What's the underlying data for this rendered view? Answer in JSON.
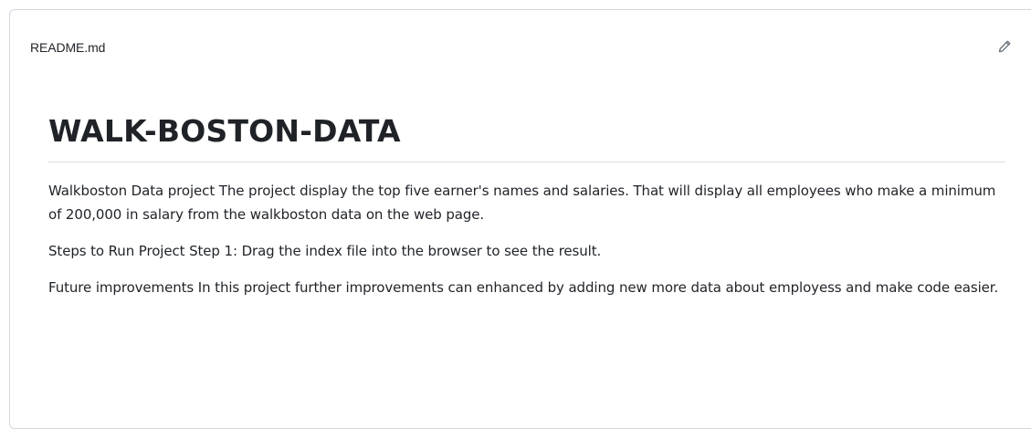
{
  "readme": {
    "filename": "README.md",
    "edit_icon": "pencil-icon",
    "title": "WALK-BOSTON-DATA",
    "paragraphs": [
      "Walkboston Data project The project display the top five earner's names and salaries. That will display all employees who make a minimum of 200,000 in salary from the walkboston data on the web page.",
      "Steps to Run Project Step 1: Drag the index file into the browser to see the result.",
      "Future improvements In this project further improvements can enhanced by adding new more data about employess and make code easier."
    ]
  },
  "colors": {
    "text": "#1f2328",
    "border": "#d0d7de",
    "rule": "#d8dee4",
    "icon": "#656d76"
  }
}
